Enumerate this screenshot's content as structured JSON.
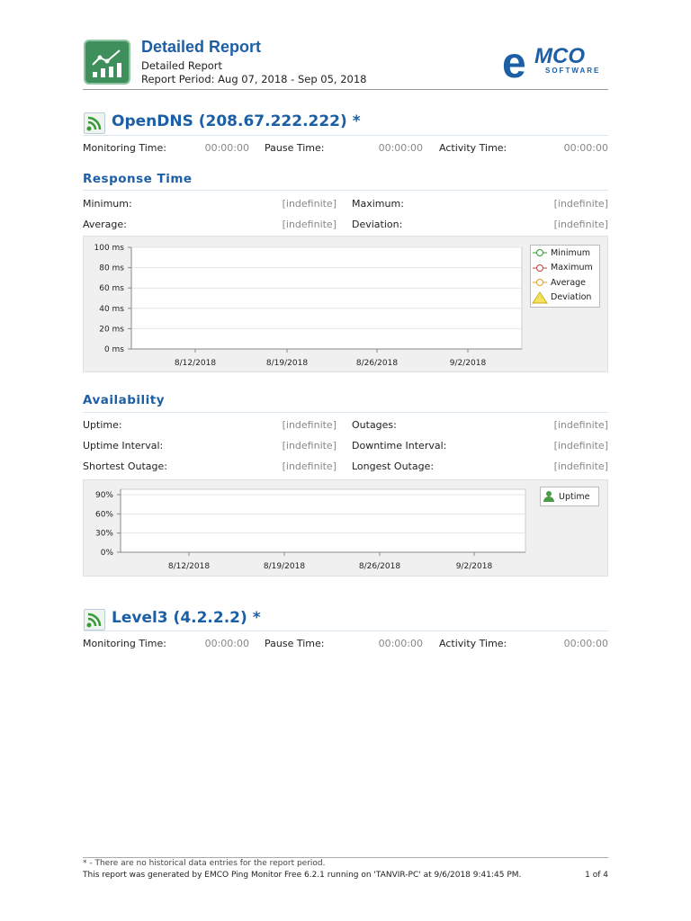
{
  "header": {
    "title": "Detailed Report",
    "subtitle": "Detailed Report",
    "period": "Report Period: Aug 07, 2018 - Sep 05, 2018",
    "brand_main": "MCO",
    "brand_sub": "SOFTWARE"
  },
  "hosts": [
    {
      "name": "OpenDNS (208.67.222.222) *",
      "monitoring_label": "Monitoring Time:",
      "monitoring": "00:00:00",
      "pause_label": "Pause Time:",
      "pause": "00:00:00",
      "activity_label": "Activity Time:",
      "activity": "00:00:00",
      "response": {
        "title": "Response Time",
        "min_label": "Minimum:",
        "min": "[indefinite]",
        "max_label": "Maximum:",
        "max": "[indefinite]",
        "avg_label": "Average:",
        "avg": "[indefinite]",
        "dev_label": "Deviation:",
        "dev": "[indefinite]"
      },
      "availability": {
        "title": "Availability",
        "uptime_label": "Uptime:",
        "uptime": "[indefinite]",
        "outages_label": "Outages:",
        "outages": "[indefinite]",
        "uptime_int_label": "Uptime Interval:",
        "uptime_int": "[indefinite]",
        "down_int_label": "Downtime Interval:",
        "down_int": "[indefinite]",
        "short_label": "Shortest Outage:",
        "short": "[indefinite]",
        "long_label": "Longest Outage:",
        "long": "[indefinite]"
      }
    },
    {
      "name": "Level3 (4.2.2.2) *",
      "monitoring_label": "Monitoring Time:",
      "monitoring": "00:00:00",
      "pause_label": "Pause Time:",
      "pause": "00:00:00",
      "activity_label": "Activity Time:",
      "activity": "00:00:00"
    }
  ],
  "chart_data": [
    {
      "type": "line",
      "title": "Response Time",
      "yticks": [
        "100 ms",
        "80 ms",
        "60 ms",
        "40 ms",
        "20 ms",
        "0 ms"
      ],
      "ylim": [
        0,
        100
      ],
      "xticks": [
        "8/12/2018",
        "8/19/2018",
        "8/26/2018",
        "9/2/2018"
      ],
      "legend": [
        "Minimum",
        "Maximum",
        "Average",
        "Deviation"
      ],
      "legend_position": "top-right",
      "series": [],
      "grid": true
    },
    {
      "type": "area",
      "title": "Availability",
      "yticks": [
        "90%",
        "60%",
        "30%",
        "0%"
      ],
      "xticks": [
        "8/12/2018",
        "8/19/2018",
        "8/26/2018",
        "9/2/2018"
      ],
      "legend": [
        "Uptime"
      ],
      "legend_position": "top-right",
      "series": [],
      "grid": true
    }
  ],
  "footer": {
    "note": "* - There are no historical data entries for the report period.",
    "generated": "This report was generated by EMCO Ping Monitor Free 6.2.1 running on 'TANVIR-PC' at 9/6/2018 9:41:45 PM.",
    "page": "1 of 4"
  },
  "colors": {
    "accent": "#1d5fa5",
    "min": "#2a9a2a",
    "max": "#c84040",
    "avg": "#e0a020"
  }
}
